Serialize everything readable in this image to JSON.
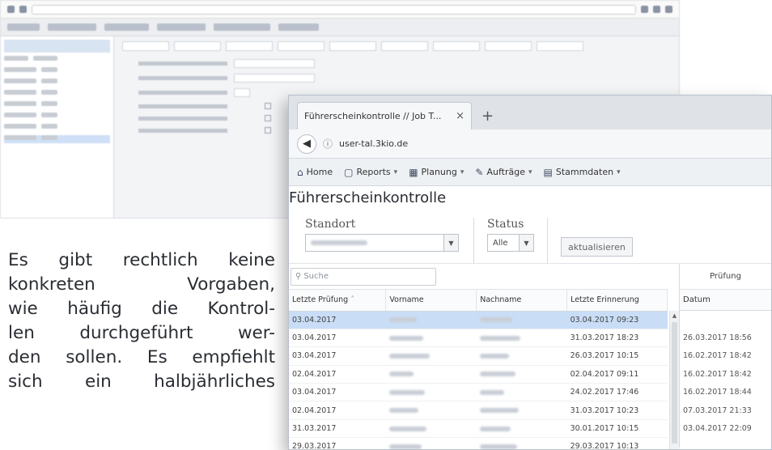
{
  "intro_lines": [
    "Es gibt rechtlich keine",
    "konkreten Vorgaben,",
    "wie häufig die Kontrol-",
    "len durchgeführt wer-",
    "den sollen. Es empfiehlt",
    "sich ein halbjährliches"
  ],
  "window": {
    "tab_title": "Führerscheinkontrolle // Job T...",
    "tab_close": "×",
    "new_tab": "+",
    "url": "user-tal.3kio.de",
    "nav": [
      {
        "icon": "home-icon",
        "glyph": "⌂",
        "label": "Home",
        "caret": false
      },
      {
        "icon": "report-icon",
        "glyph": "▢",
        "label": "Reports",
        "caret": true
      },
      {
        "icon": "calendar-icon",
        "glyph": "▦",
        "label": "Planung",
        "caret": true
      },
      {
        "icon": "wrench-icon",
        "glyph": "✎",
        "label": "Aufträge",
        "caret": true
      },
      {
        "icon": "masterdata-icon",
        "glyph": "▤",
        "label": "Stammdaten",
        "caret": true
      }
    ],
    "page_title": "Führerscheinkontrolle",
    "filters": {
      "standort_label": "Standort",
      "status_label": "Status",
      "status_value": "Alle",
      "refresh_label": "aktualisieren"
    },
    "search_placeholder": "Suche",
    "columns": [
      "Letzte Prüfung",
      "Vorname",
      "Nachname",
      "Letzte Erinnerung"
    ],
    "rows": [
      {
        "last_check": "03.04.2017",
        "last_reminder": "03.04.2017 09:23",
        "selected": true
      },
      {
        "last_check": "03.04.2017",
        "last_reminder": "31.03.2017 18:23",
        "selected": false
      },
      {
        "last_check": "03.04.2017",
        "last_reminder": "26.03.2017 10:15",
        "selected": false
      },
      {
        "last_check": "02.04.2017",
        "last_reminder": "02.04.2017 09:11",
        "selected": false
      },
      {
        "last_check": "03.04.2017",
        "last_reminder": "24.02.2017 17:46",
        "selected": false
      },
      {
        "last_check": "02.04.2017",
        "last_reminder": "31.03.2017 10:23",
        "selected": false
      },
      {
        "last_check": "31.03.2017",
        "last_reminder": "30.01.2017 10:15",
        "selected": false
      },
      {
        "last_check": "29.03.2017",
        "last_reminder": "29.03.2017 10:13",
        "selected": false
      }
    ],
    "right_panel": {
      "header": "Prüfung",
      "column": "Datum",
      "values": [
        "",
        "26.03.2017 18:56",
        "16.02.2017 18:42",
        "16.02.2017 18:42",
        "16.02.2017 18:44",
        "07.03.2017 21:33",
        "03.04.2017 22:09",
        ""
      ]
    }
  }
}
